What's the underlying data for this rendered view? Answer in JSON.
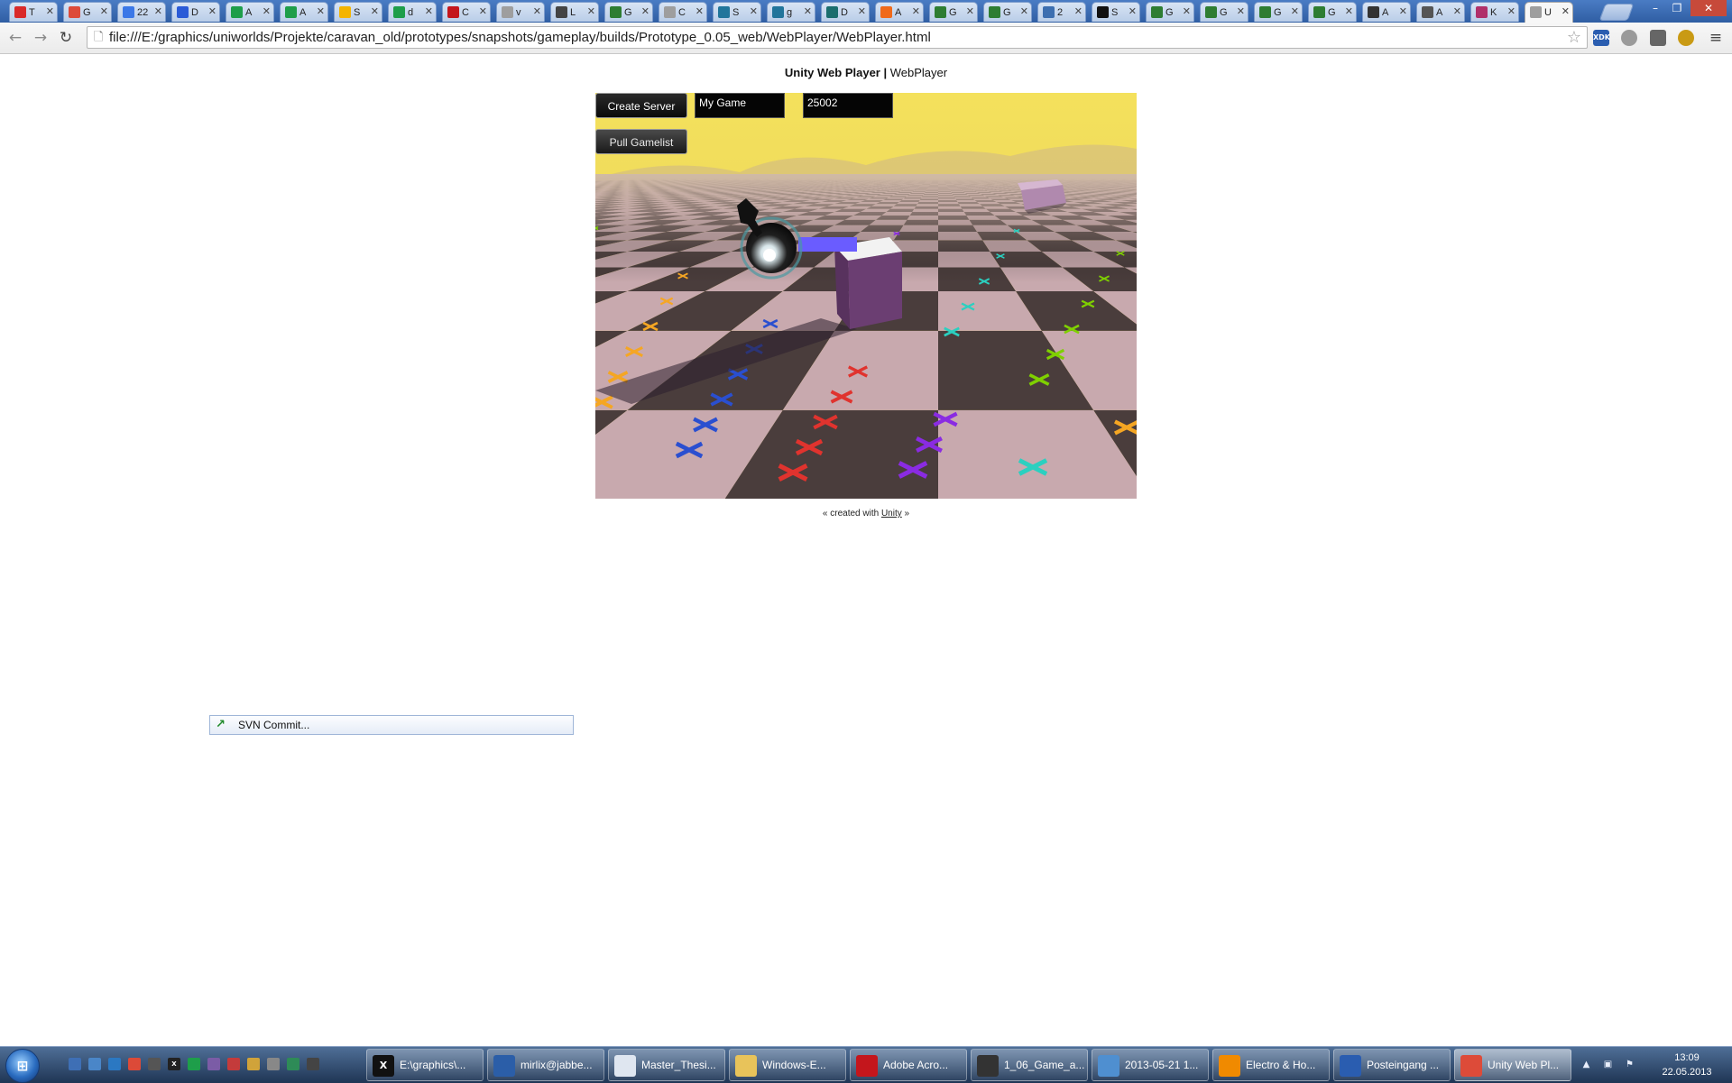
{
  "browser": {
    "tabs": [
      {
        "letter": "T",
        "color": "#d92a2a"
      },
      {
        "letter": "G",
        "color": "#dd4b39"
      },
      {
        "letter": "22",
        "color": "#3b78e7"
      },
      {
        "letter": "D",
        "color": "#2a5bd7"
      },
      {
        "letter": "A",
        "color": "#1e9e4a"
      },
      {
        "letter": "A",
        "color": "#1e9e4a"
      },
      {
        "letter": "S",
        "color": "#f4b400"
      },
      {
        "letter": "d",
        "color": "#1e9e4a"
      },
      {
        "letter": "C",
        "color": "#c4161c"
      },
      {
        "letter": "v",
        "color": "#9e9e9e"
      },
      {
        "letter": "L",
        "color": "#444444"
      },
      {
        "letter": "G",
        "color": "#2e7d32"
      },
      {
        "letter": "C",
        "color": "#9e9e9e"
      },
      {
        "letter": "S",
        "color": "#21759b"
      },
      {
        "letter": "g",
        "color": "#21759b"
      },
      {
        "letter": "D",
        "color": "#1b6e6e"
      },
      {
        "letter": "A",
        "color": "#f06a1a"
      },
      {
        "letter": "G",
        "color": "#2e7d32"
      },
      {
        "letter": "G",
        "color": "#2e7d32"
      },
      {
        "letter": "2",
        "color": "#3d6fb0"
      },
      {
        "letter": "S",
        "color": "#111111"
      },
      {
        "letter": "G",
        "color": "#2e7d32"
      },
      {
        "letter": "G",
        "color": "#2e7d32"
      },
      {
        "letter": "G",
        "color": "#2e7d32"
      },
      {
        "letter": "G",
        "color": "#2e7d32"
      },
      {
        "letter": "A",
        "color": "#333333"
      },
      {
        "letter": "A",
        "color": "#555555"
      },
      {
        "letter": "K",
        "color": "#b0306a"
      },
      {
        "letter": "U",
        "color": "#9e9e9e",
        "active": true
      }
    ],
    "url": "file:///E:/graphics/uniworlds/Projekte/caravan_old/prototypes/snapshots/gameplay/builds/Prototype_0.05_web/WebPlayer/WebPlayer.html",
    "extensions": [
      {
        "label": "XDK",
        "color": "#2a5db0"
      },
      {
        "label": "",
        "color": "#9a9a9a"
      },
      {
        "label": "",
        "color": "#666666"
      },
      {
        "label": "",
        "color": "#c99a14"
      }
    ],
    "window_controls": {
      "minimize": "–",
      "restore": "❐",
      "close": "✕"
    },
    "glyphs": {
      "back": "←",
      "forward": "→",
      "reload": "↻",
      "page": "🗋",
      "star": "☆",
      "menu": "≡",
      "tab_close": "✕"
    }
  },
  "page": {
    "heading_bold": "Unity Web Player |",
    "heading_rest": " WebPlayer",
    "footer_prefix": "« created with ",
    "footer_link": "Unity",
    "footer_suffix": " »"
  },
  "game": {
    "create_server_label": "Create Server",
    "game_name_value": "My Game",
    "port_value": "25002",
    "pull_gamelist_label": "Pull Gamelist",
    "colors": {
      "sky": "#f2de5a",
      "tile_light": "#c8a9ae",
      "tile_dark": "#4a3d3c",
      "cube": "#6b3e72",
      "health_bar": "#6a5cff"
    }
  },
  "svn_popup": {
    "label": "SVN Commit...",
    "icon": "↗"
  },
  "taskbar": {
    "start_glyph": "⊞",
    "quick_launch": [
      {
        "color": "#3e6fb5",
        "glyph": ""
      },
      {
        "color": "#4a86c8",
        "glyph": ""
      },
      {
        "color": "#2b78c2",
        "glyph": ""
      },
      {
        "color": "#dc4a38",
        "glyph": ""
      },
      {
        "color": "#555555",
        "glyph": ""
      },
      {
        "color": "#222222",
        "glyph": "X"
      },
      {
        "color": "#1e9e4a",
        "glyph": ""
      },
      {
        "color": "#7b5ca6",
        "glyph": ""
      },
      {
        "color": "#c43b3b",
        "glyph": ""
      },
      {
        "color": "#d0a33a",
        "glyph": ""
      },
      {
        "color": "#888888",
        "glyph": ""
      },
      {
        "color": "#2e8b57",
        "glyph": ""
      },
      {
        "color": "#444444",
        "glyph": ""
      }
    ],
    "buttons": [
      {
        "label": "E:\\graphics\\...",
        "icon_color": "#111111",
        "glyph": "X"
      },
      {
        "label": "mirlix@jabbe...",
        "icon_color": "#2b5ea8",
        "glyph": ""
      },
      {
        "label": "Master_Thesi...",
        "icon_color": "#dfe6f0",
        "glyph": ""
      },
      {
        "label": "Windows-E...",
        "icon_color": "#e8c35a",
        "glyph": ""
      },
      {
        "label": "Adobe Acro...",
        "icon_color": "#c4161c",
        "glyph": ""
      },
      {
        "label": "1_06_Game_a...",
        "icon_color": "#333333",
        "glyph": ""
      },
      {
        "label": "2013-05-21 1...",
        "icon_color": "#4f8fd0",
        "glyph": ""
      },
      {
        "label": "Electro & Ho...",
        "icon_color": "#f08a00",
        "glyph": ""
      },
      {
        "label": "Posteingang ...",
        "icon_color": "#2a5db0",
        "glyph": ""
      },
      {
        "label": "Unity Web Pl...",
        "icon_color": "#dd4b39",
        "glyph": "",
        "active": true
      }
    ],
    "tray_glyphs": [
      "▲",
      "▣",
      "⚑"
    ],
    "time": "13:09",
    "date": "22.05.2013"
  }
}
